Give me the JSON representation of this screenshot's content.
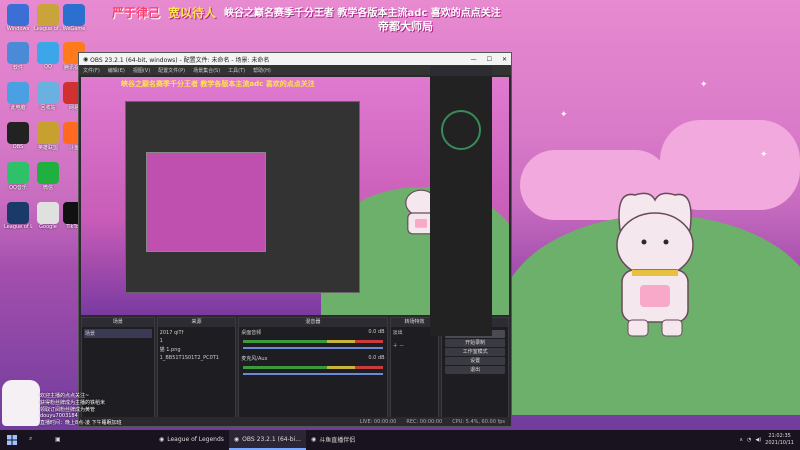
{
  "banner": {
    "left_text_1": "严于律己",
    "left_text_2": "宽以待人",
    "title": "峡谷之巅名赛季千分王者 教学各版本主流adc 喜欢的点点关注",
    "subtitle": "帝都大师局"
  },
  "desktop_icons": [
    {
      "label": "Windows",
      "color": "#3b6fd6"
    },
    {
      "label": "League of...",
      "color": "#c9a43a"
    },
    {
      "label": "WeGame",
      "color": "#2b6fcf"
    },
    {
      "label": "软件",
      "color": "#4a8ad6"
    },
    {
      "label": "QQ",
      "color": "#3ba6e8"
    },
    {
      "label": "腾讯视频",
      "color": "#ff7a1a"
    },
    {
      "label": "此电脑",
      "color": "#4aa0e0"
    },
    {
      "label": "回收站",
      "color": "#6ab0e0"
    },
    {
      "label": "网易",
      "color": "#d03030"
    },
    {
      "label": "OBS",
      "color": "#222222"
    },
    {
      "label": "英雄联盟",
      "color": "#c8a030"
    },
    {
      "label": "斗鱼",
      "color": "#ff6a20"
    },
    {
      "label": "QQ音乐",
      "color": "#2fc06a"
    },
    {
      "label": "微信",
      "color": "#20b040"
    },
    {
      "label": "League of Legends",
      "color": "#1a3a6a"
    },
    {
      "label": "Google",
      "color": "#e0e0e0"
    },
    {
      "label": "TikTok",
      "color": "#111111"
    }
  ],
  "obs": {
    "window_title": "OBS 23.2.1 (64-bit, windows) - 配置文件: 未命名 - 场景: 未命名",
    "menus": [
      "文件(F)",
      "编辑(E)",
      "视图(V)",
      "配置文件(P)",
      "场景集合(S)",
      "工具(T)",
      "帮助(H)"
    ],
    "docks": {
      "scenes": {
        "header": "场景",
        "items": [
          "场景"
        ]
      },
      "sources": {
        "header": "来源",
        "items": [
          "2017 qiTf",
          "1",
          "猫 1.png",
          "1_BB51T1S01T2_PC0T1"
        ]
      },
      "mixer": {
        "header": "混音器",
        "tracks": [
          {
            "name": "桌面音频",
            "db": "0.0 dB"
          },
          {
            "name": "麦克风/Aux",
            "db": "0.0 dB"
          }
        ]
      },
      "transitions": {
        "header": "转场特效",
        "type": "淡出"
      },
      "controls": {
        "header": "控件",
        "buttons": [
          "停止推流",
          "开始录制",
          "工作室模式",
          "设置",
          "退出"
        ]
      }
    },
    "statusbar": [
      "LIVE: 00:00:00",
      "REC: 00:00:00",
      "CPU: 5.4%, 60.00 fps"
    ]
  },
  "chat": {
    "lines": [
      "欢迎主播的点点关注~",
      "获得粉丝牌成为主播的铁稻米",
      "领取订阅粉丝牌成为黄管",
      "douyu7003184",
      "直播时间：晚上8点-凌 下午睡眠加班"
    ]
  },
  "taskbar": {
    "items": [
      {
        "label": "League of Legends",
        "active": false
      },
      {
        "label": "OBS 23.2.1 (64-bi...",
        "active": true
      },
      {
        "label": "斗鱼直播伴侣",
        "active": false
      }
    ],
    "time": "21:02:35",
    "date": "2021/10/11"
  }
}
